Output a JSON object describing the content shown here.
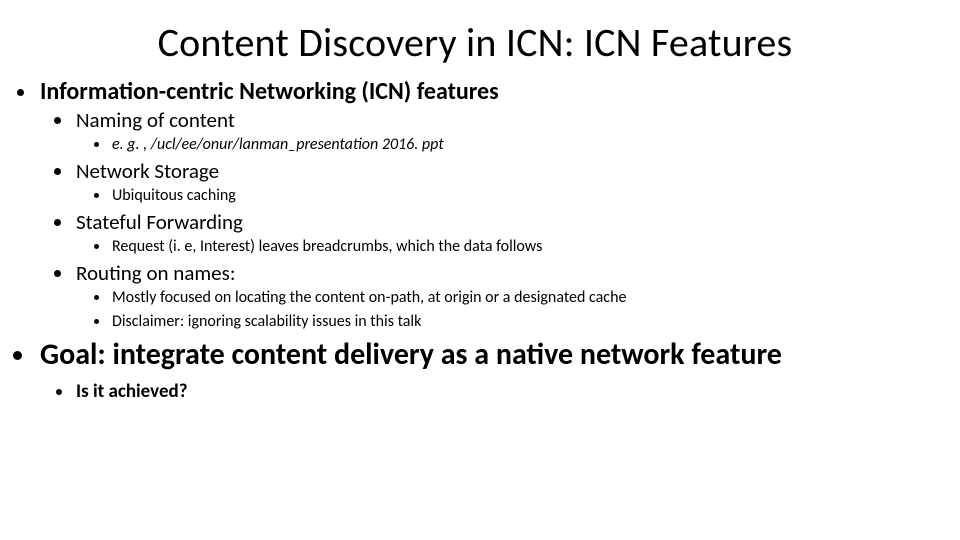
{
  "title": "Content Discovery in ICN: ICN Features",
  "features": {
    "heading": "Information-centric Networking (ICN) features",
    "items": [
      {
        "label": "Naming of content",
        "sub": [
          {
            "text": "e. g. , /ucl/ee/onur/lanman_presentation 2016. ppt",
            "italic": true
          }
        ]
      },
      {
        "label": "Network Storage",
        "sub": [
          {
            "text": "Ubiquitous caching"
          }
        ]
      },
      {
        "label": "Stateful Forwarding",
        "sub": [
          {
            "text": "Request (i. e, Interest) leaves breadcrumbs, which the data follows"
          }
        ]
      },
      {
        "label": "Routing on names:",
        "sub": [
          {
            "text": "Mostly focused on locating the content on-path, at origin or a designated cache"
          },
          {
            "text": "Disclaimer: ignoring scalability issues in this talk"
          }
        ]
      }
    ]
  },
  "goal": {
    "heading": "Goal: integrate content delivery as a native network feature",
    "sub": "Is it achieved?"
  }
}
